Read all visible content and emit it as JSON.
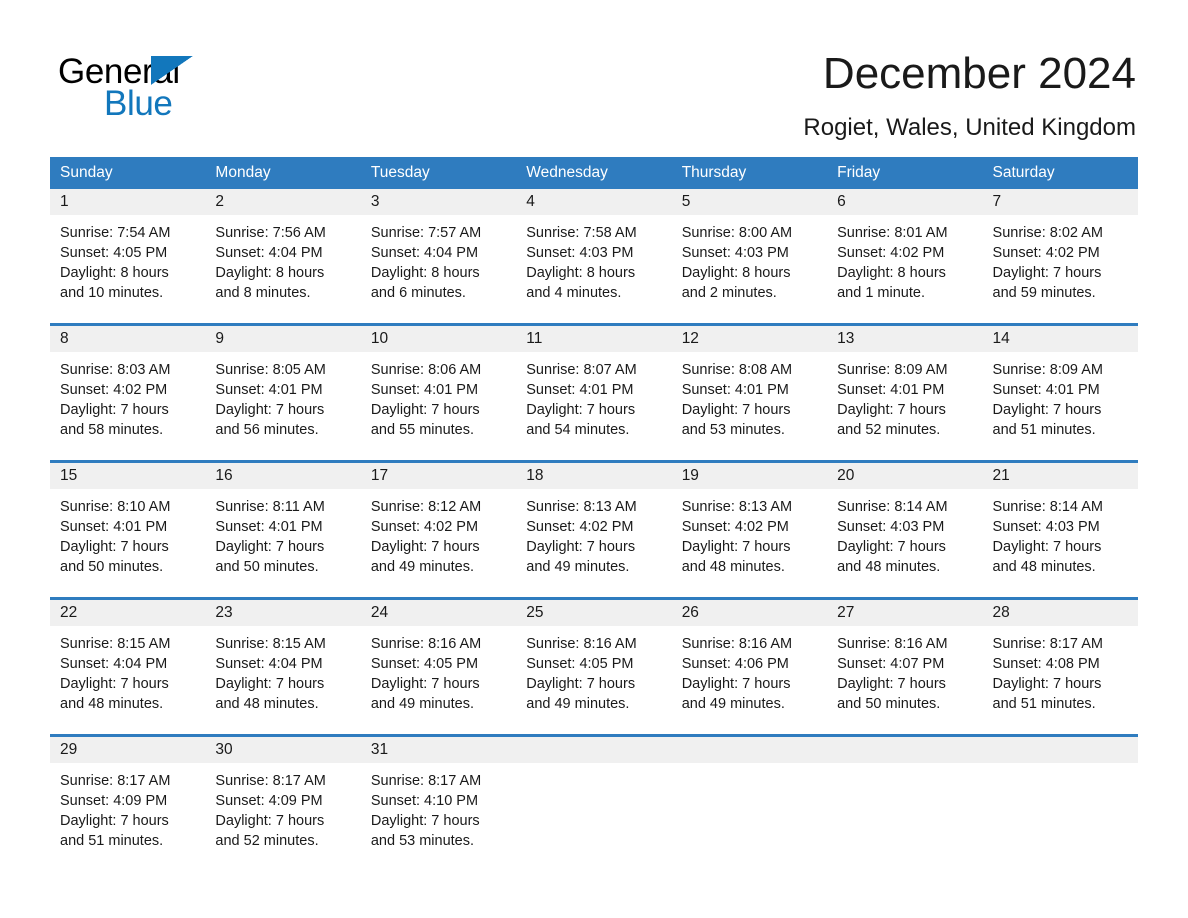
{
  "brand": {
    "name_part1": "General",
    "name_part2": "Blue",
    "triangle_icon": "triangle-icon",
    "accent_color": "#1277bc"
  },
  "header": {
    "month_title": "December 2024",
    "location": "Rogiet, Wales, United Kingdom"
  },
  "calendar": {
    "header_color": "#2f7cbf",
    "daynum_band_color": "#f0f0f0",
    "weekdays": [
      "Sunday",
      "Monday",
      "Tuesday",
      "Wednesday",
      "Thursday",
      "Friday",
      "Saturday"
    ],
    "weeks": [
      [
        {
          "day": "1",
          "sunrise": "Sunrise: 7:54 AM",
          "sunset": "Sunset: 4:05 PM",
          "daylight1": "Daylight: 8 hours",
          "daylight2": "and 10 minutes."
        },
        {
          "day": "2",
          "sunrise": "Sunrise: 7:56 AM",
          "sunset": "Sunset: 4:04 PM",
          "daylight1": "Daylight: 8 hours",
          "daylight2": "and 8 minutes."
        },
        {
          "day": "3",
          "sunrise": "Sunrise: 7:57 AM",
          "sunset": "Sunset: 4:04 PM",
          "daylight1": "Daylight: 8 hours",
          "daylight2": "and 6 minutes."
        },
        {
          "day": "4",
          "sunrise": "Sunrise: 7:58 AM",
          "sunset": "Sunset: 4:03 PM",
          "daylight1": "Daylight: 8 hours",
          "daylight2": "and 4 minutes."
        },
        {
          "day": "5",
          "sunrise": "Sunrise: 8:00 AM",
          "sunset": "Sunset: 4:03 PM",
          "daylight1": "Daylight: 8 hours",
          "daylight2": "and 2 minutes."
        },
        {
          "day": "6",
          "sunrise": "Sunrise: 8:01 AM",
          "sunset": "Sunset: 4:02 PM",
          "daylight1": "Daylight: 8 hours",
          "daylight2": "and 1 minute."
        },
        {
          "day": "7",
          "sunrise": "Sunrise: 8:02 AM",
          "sunset": "Sunset: 4:02 PM",
          "daylight1": "Daylight: 7 hours",
          "daylight2": "and 59 minutes."
        }
      ],
      [
        {
          "day": "8",
          "sunrise": "Sunrise: 8:03 AM",
          "sunset": "Sunset: 4:02 PM",
          "daylight1": "Daylight: 7 hours",
          "daylight2": "and 58 minutes."
        },
        {
          "day": "9",
          "sunrise": "Sunrise: 8:05 AM",
          "sunset": "Sunset: 4:01 PM",
          "daylight1": "Daylight: 7 hours",
          "daylight2": "and 56 minutes."
        },
        {
          "day": "10",
          "sunrise": "Sunrise: 8:06 AM",
          "sunset": "Sunset: 4:01 PM",
          "daylight1": "Daylight: 7 hours",
          "daylight2": "and 55 minutes."
        },
        {
          "day": "11",
          "sunrise": "Sunrise: 8:07 AM",
          "sunset": "Sunset: 4:01 PM",
          "daylight1": "Daylight: 7 hours",
          "daylight2": "and 54 minutes."
        },
        {
          "day": "12",
          "sunrise": "Sunrise: 8:08 AM",
          "sunset": "Sunset: 4:01 PM",
          "daylight1": "Daylight: 7 hours",
          "daylight2": "and 53 minutes."
        },
        {
          "day": "13",
          "sunrise": "Sunrise: 8:09 AM",
          "sunset": "Sunset: 4:01 PM",
          "daylight1": "Daylight: 7 hours",
          "daylight2": "and 52 minutes."
        },
        {
          "day": "14",
          "sunrise": "Sunrise: 8:09 AM",
          "sunset": "Sunset: 4:01 PM",
          "daylight1": "Daylight: 7 hours",
          "daylight2": "and 51 minutes."
        }
      ],
      [
        {
          "day": "15",
          "sunrise": "Sunrise: 8:10 AM",
          "sunset": "Sunset: 4:01 PM",
          "daylight1": "Daylight: 7 hours",
          "daylight2": "and 50 minutes."
        },
        {
          "day": "16",
          "sunrise": "Sunrise: 8:11 AM",
          "sunset": "Sunset: 4:01 PM",
          "daylight1": "Daylight: 7 hours",
          "daylight2": "and 50 minutes."
        },
        {
          "day": "17",
          "sunrise": "Sunrise: 8:12 AM",
          "sunset": "Sunset: 4:02 PM",
          "daylight1": "Daylight: 7 hours",
          "daylight2": "and 49 minutes."
        },
        {
          "day": "18",
          "sunrise": "Sunrise: 8:13 AM",
          "sunset": "Sunset: 4:02 PM",
          "daylight1": "Daylight: 7 hours",
          "daylight2": "and 49 minutes."
        },
        {
          "day": "19",
          "sunrise": "Sunrise: 8:13 AM",
          "sunset": "Sunset: 4:02 PM",
          "daylight1": "Daylight: 7 hours",
          "daylight2": "and 48 minutes."
        },
        {
          "day": "20",
          "sunrise": "Sunrise: 8:14 AM",
          "sunset": "Sunset: 4:03 PM",
          "daylight1": "Daylight: 7 hours",
          "daylight2": "and 48 minutes."
        },
        {
          "day": "21",
          "sunrise": "Sunrise: 8:14 AM",
          "sunset": "Sunset: 4:03 PM",
          "daylight1": "Daylight: 7 hours",
          "daylight2": "and 48 minutes."
        }
      ],
      [
        {
          "day": "22",
          "sunrise": "Sunrise: 8:15 AM",
          "sunset": "Sunset: 4:04 PM",
          "daylight1": "Daylight: 7 hours",
          "daylight2": "and 48 minutes."
        },
        {
          "day": "23",
          "sunrise": "Sunrise: 8:15 AM",
          "sunset": "Sunset: 4:04 PM",
          "daylight1": "Daylight: 7 hours",
          "daylight2": "and 48 minutes."
        },
        {
          "day": "24",
          "sunrise": "Sunrise: 8:16 AM",
          "sunset": "Sunset: 4:05 PM",
          "daylight1": "Daylight: 7 hours",
          "daylight2": "and 49 minutes."
        },
        {
          "day": "25",
          "sunrise": "Sunrise: 8:16 AM",
          "sunset": "Sunset: 4:05 PM",
          "daylight1": "Daylight: 7 hours",
          "daylight2": "and 49 minutes."
        },
        {
          "day": "26",
          "sunrise": "Sunrise: 8:16 AM",
          "sunset": "Sunset: 4:06 PM",
          "daylight1": "Daylight: 7 hours",
          "daylight2": "and 49 minutes."
        },
        {
          "day": "27",
          "sunrise": "Sunrise: 8:16 AM",
          "sunset": "Sunset: 4:07 PM",
          "daylight1": "Daylight: 7 hours",
          "daylight2": "and 50 minutes."
        },
        {
          "day": "28",
          "sunrise": "Sunrise: 8:17 AM",
          "sunset": "Sunset: 4:08 PM",
          "daylight1": "Daylight: 7 hours",
          "daylight2": "and 51 minutes."
        }
      ],
      [
        {
          "day": "29",
          "sunrise": "Sunrise: 8:17 AM",
          "sunset": "Sunset: 4:09 PM",
          "daylight1": "Daylight: 7 hours",
          "daylight2": "and 51 minutes."
        },
        {
          "day": "30",
          "sunrise": "Sunrise: 8:17 AM",
          "sunset": "Sunset: 4:09 PM",
          "daylight1": "Daylight: 7 hours",
          "daylight2": "and 52 minutes."
        },
        {
          "day": "31",
          "sunrise": "Sunrise: 8:17 AM",
          "sunset": "Sunset: 4:10 PM",
          "daylight1": "Daylight: 7 hours",
          "daylight2": "and 53 minutes."
        },
        {
          "day": "",
          "sunrise": "",
          "sunset": "",
          "daylight1": "",
          "daylight2": ""
        },
        {
          "day": "",
          "sunrise": "",
          "sunset": "",
          "daylight1": "",
          "daylight2": ""
        },
        {
          "day": "",
          "sunrise": "",
          "sunset": "",
          "daylight1": "",
          "daylight2": ""
        },
        {
          "day": "",
          "sunrise": "",
          "sunset": "",
          "daylight1": "",
          "daylight2": ""
        }
      ]
    ]
  }
}
